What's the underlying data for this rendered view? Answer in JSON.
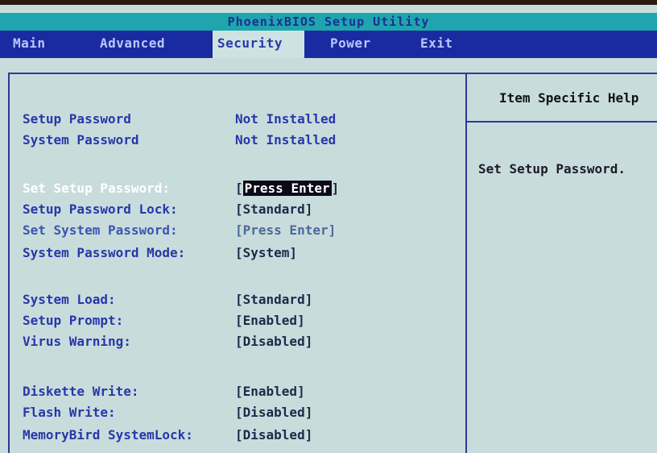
{
  "title": "PhoenixBIOS Setup Utility",
  "menu": {
    "tabs": [
      {
        "label": "Main"
      },
      {
        "label": "Advanced"
      },
      {
        "label": "Security"
      },
      {
        "label": "Power"
      },
      {
        "label": "Exit"
      }
    ]
  },
  "help": {
    "title": "Item Specific Help",
    "text": "Set Setup Password."
  },
  "settings": {
    "setup_password": {
      "label": "Setup Password",
      "value": "Not Installed"
    },
    "system_password": {
      "label": "System Password",
      "value": "Not Installed"
    },
    "set_setup_password": {
      "label": "Set Setup Password:",
      "value_open": "[",
      "value": "Press Enter",
      "value_close": "]"
    },
    "setup_password_lock": {
      "label": "Setup Password Lock:",
      "value": "[Standard]"
    },
    "set_system_password": {
      "label": "Set System Password:",
      "value": "[Press Enter]"
    },
    "system_password_mode": {
      "label": "System Password Mode:",
      "value": "[System]"
    },
    "system_load": {
      "label": "System Load:",
      "value": "[Standard]"
    },
    "setup_prompt": {
      "label": "Setup Prompt:",
      "value": "[Enabled]"
    },
    "virus_warning": {
      "label": "Virus Warning:",
      "value": "[Disabled]"
    },
    "diskette_write": {
      "label": "Diskette Write:",
      "value": "[Enabled]"
    },
    "flash_write": {
      "label": "Flash Write:",
      "value": "[Disabled]"
    },
    "memorybird_systemlock": {
      "label": "MemoryBird SystemLock:",
      "value": "[Disabled]"
    }
  },
  "colors": {
    "title_bar": "#1fa5ad",
    "menu_bar": "#1a2aa0",
    "panel_background": "#c9dcdc",
    "label_text": "#2638a8",
    "selection_highlight": "#0a0a18"
  }
}
